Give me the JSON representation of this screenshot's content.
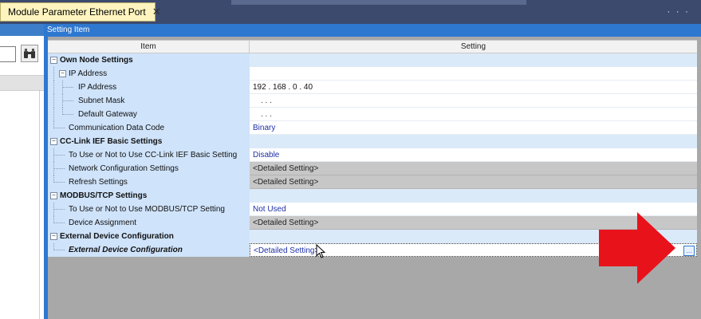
{
  "tab": {
    "title": "Module Parameter Ethernet Port",
    "close_label": "✕"
  },
  "tab_menu": "· · ·",
  "panel": {
    "title": "Setting Item"
  },
  "table": {
    "headers": {
      "item": "Item",
      "setting": "Setting"
    },
    "rows": [
      {
        "label": "Own Node Settings",
        "setting": ""
      },
      {
        "label": "IP Address",
        "setting": ""
      },
      {
        "label": "IP Address",
        "setting": "192 . 168 .  0 .  40"
      },
      {
        "label": "Subnet Mask",
        "setting": ".    .    ."
      },
      {
        "label": "Default Gateway",
        "setting": ".    .    ."
      },
      {
        "label": "Communication Data Code",
        "setting": "Binary"
      },
      {
        "label": "CC-Link IEF Basic Settings",
        "setting": ""
      },
      {
        "label": "To Use or Not to Use CC-Link IEF Basic Setting",
        "setting": "Disable"
      },
      {
        "label": "Network Configuration Settings",
        "setting": "<Detailed Setting>"
      },
      {
        "label": "Refresh Settings",
        "setting": "<Detailed Setting>"
      },
      {
        "label": "MODBUS/TCP Settings",
        "setting": ""
      },
      {
        "label": "To Use or Not to Use MODBUS/TCP Setting",
        "setting": "Not Used"
      },
      {
        "label": "Device Assignment",
        "setting": "<Detailed Setting>"
      },
      {
        "label": "External Device Configuration",
        "setting": ""
      },
      {
        "label": "External Device Configuration",
        "setting": "<Detailed Setting>"
      }
    ]
  },
  "ellipsis_label": "...",
  "colors": {
    "accent_blue": "#2e78d0",
    "arrow_red": "#e8121b",
    "tab_yellow": "#fdf4bf"
  }
}
